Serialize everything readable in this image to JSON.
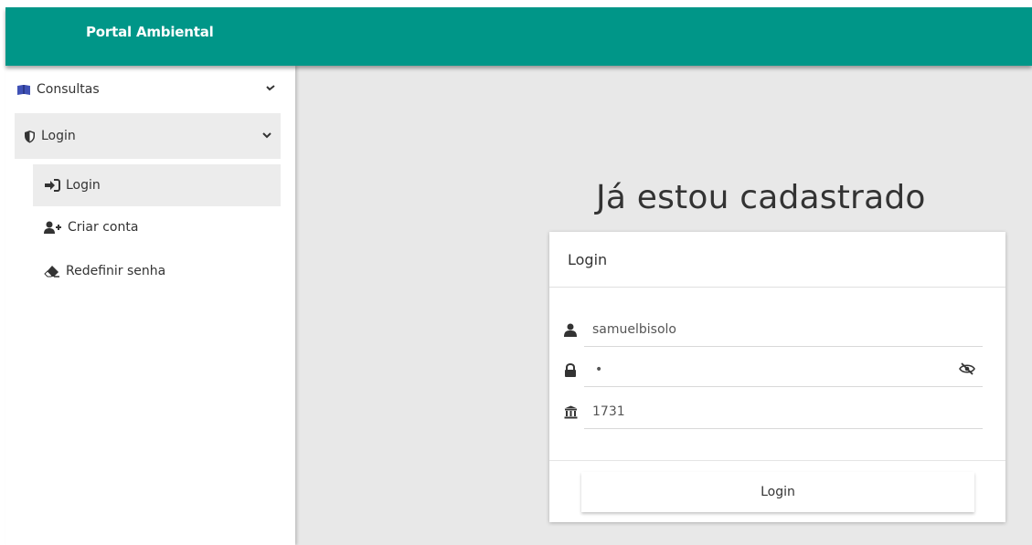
{
  "header": {
    "brand": "Portal Ambiental",
    "bar_color": "#009688"
  },
  "sidebar": {
    "consultas": {
      "label": "Consultas",
      "icon": "book-open-icon"
    },
    "login_group": {
      "label": "Login",
      "icon": "shield-icon"
    },
    "items": [
      {
        "label": "Login",
        "icon": "sign-in-icon",
        "active": true
      },
      {
        "label": "Criar conta",
        "icon": "user-plus-icon"
      },
      {
        "label": "Redefinir senha",
        "icon": "eraser-icon"
      }
    ]
  },
  "main": {
    "title": "Já estou cadastrado",
    "card": {
      "header": "Login",
      "username": {
        "value": "samuelbisolo",
        "icon": "user-icon"
      },
      "password": {
        "value": "•",
        "icon": "lock-icon",
        "toggle_icon": "eye-slash-icon"
      },
      "institution": {
        "value": "1731",
        "icon": "building-columns-icon"
      },
      "submit_label": "Login"
    }
  }
}
